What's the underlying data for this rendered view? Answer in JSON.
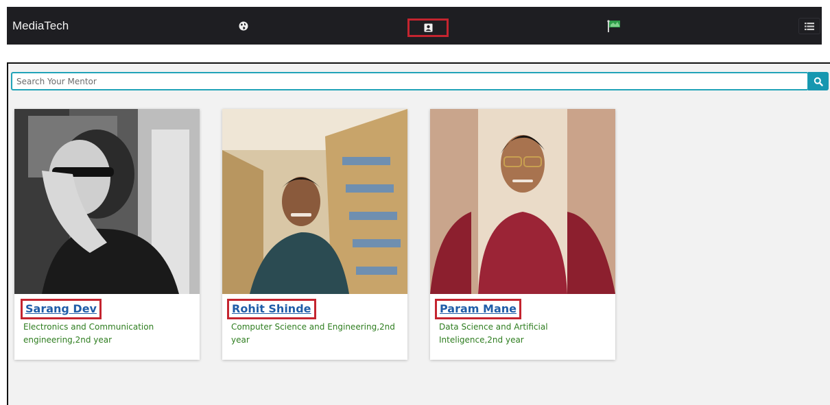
{
  "navbar": {
    "brand": "MediaTech",
    "icons": [
      "globe-icon",
      "profile-icon",
      "flag-icon",
      "menu-icon"
    ]
  },
  "search": {
    "placeholder": "Search Your Mentor",
    "button_icon": "search-icon"
  },
  "mentors": [
    {
      "name": "Sarang Dev",
      "description": "Electronics and Communication engineering,2nd year"
    },
    {
      "name": "Rohit Shinde",
      "description": "Computer Science and Engineering,2nd year"
    },
    {
      "name": "Param Mane",
      "description": "Data Science and Artificial Inteligence,2nd year"
    }
  ],
  "colors": {
    "navbar_bg": "#1e1e22",
    "highlight": "#c4242f",
    "search_accent": "#1797b0",
    "name_link": "#1f5da8",
    "description": "#2e7d1f"
  }
}
